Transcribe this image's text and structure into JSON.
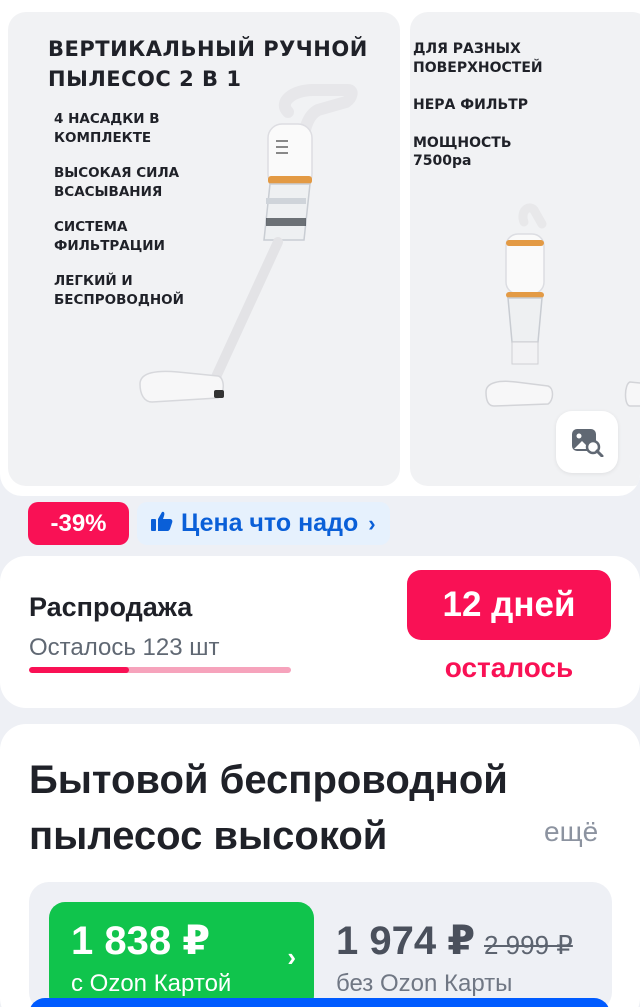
{
  "gallery": {
    "slide1": {
      "title_line1": "ВЕРТИКАЛЬНЫЙ РУЧНОЙ",
      "title_line2": "ПЫЛЕСОС 2 В 1",
      "features": [
        {
          "line1": "4 НАСАДКИ В",
          "line2": "КОМПЛЕКТЕ"
        },
        {
          "line1": "ВЫСОКАЯ СИЛА",
          "line2": "ВСАСЫВАНИЯ"
        },
        {
          "line1": "СИСТЕМА",
          "line2": "ФИЛЬТРАЦИИ"
        },
        {
          "line1": "ЛЕГКИЙ И",
          "line2": "БЕСПРОВОДНОЙ"
        }
      ]
    },
    "slide2": {
      "features": [
        {
          "line1": "ДЛЯ РАЗНЫХ",
          "line2": "ПОВЕРХНОСТЕЙ"
        },
        {
          "line1": "НЕРА ФИЛЬТР",
          "line2": ""
        },
        {
          "line1": "МОЩНОСТЬ",
          "line2": "7500ра"
        }
      ]
    },
    "search_photo_icon": "image-search-icon"
  },
  "badges": {
    "discount": "-39%",
    "price_label": "Цена что надо",
    "price_icon": "thumbs-up-icon"
  },
  "sale": {
    "title": "Распродажа",
    "remaining": "Осталось 123 шт",
    "progress_fraction": 0.38,
    "days": "12 дней",
    "days_label": "осталось"
  },
  "product": {
    "title_line1": "Бытовой беспроводной",
    "title_line2": "пылесос высокой",
    "more": "ещё",
    "ozon_price": "1 838 ₽",
    "ozon_price_sub": "с Ozon Картой",
    "regular_price": "1 974 ₽",
    "old_price": "2 999 ₽",
    "regular_sub": "без Ozon Карты"
  },
  "colors": {
    "accent_pink": "#f91155",
    "accent_blue": "#005bff",
    "ozon_green": "#10c44c"
  }
}
